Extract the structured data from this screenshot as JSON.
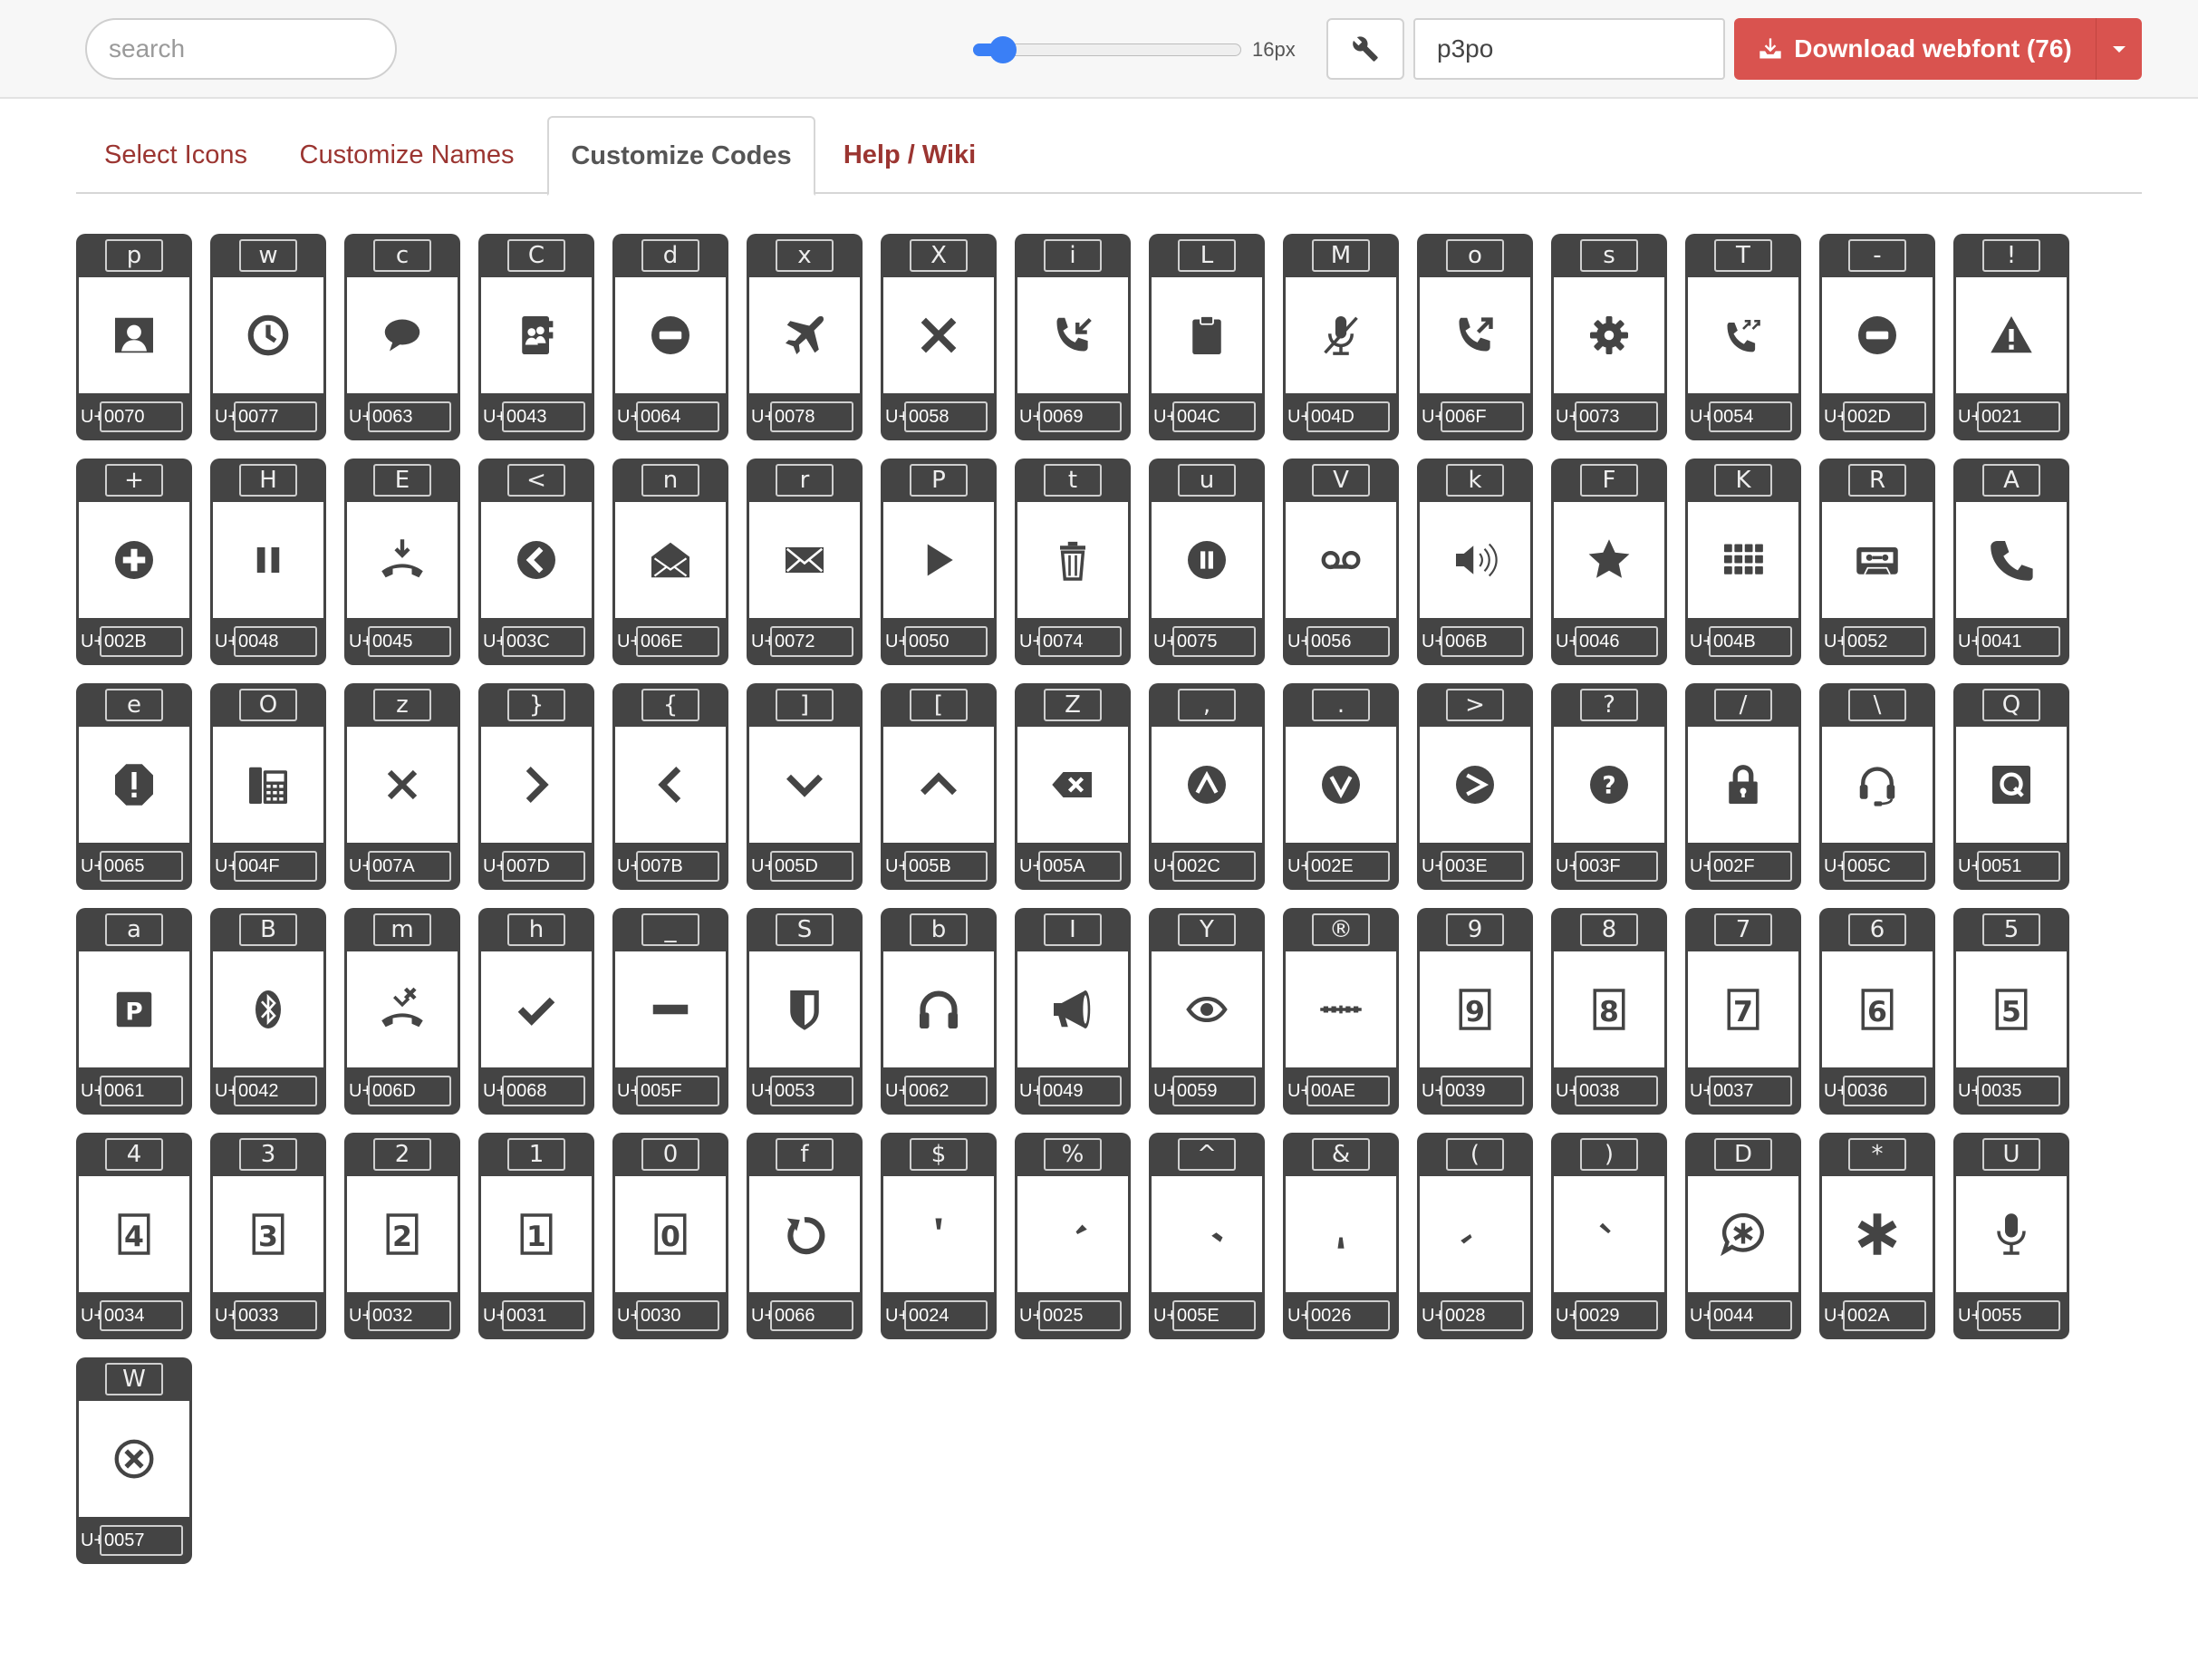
{
  "toolbar": {
    "search_placeholder": "search",
    "font_size_label": "16px",
    "font_size_value": 16,
    "font_size_min": 12,
    "font_size_max": 48,
    "prefix_value": "p3po",
    "download_label": "Download webfont (76)",
    "accent_color": "#d9534f",
    "slider_color": "#3a7ff6"
  },
  "tabs": [
    {
      "label": "Select Icons",
      "active": false
    },
    {
      "label": "Customize Names",
      "active": false
    },
    {
      "label": "Customize Codes",
      "active": true
    },
    {
      "label": "Help / Wiki",
      "active": false
    }
  ],
  "code_prefix": "U+",
  "icons": [
    {
      "key": "p",
      "code": "0070",
      "icon": "contact-portrait-icon"
    },
    {
      "key": "w",
      "code": "0077",
      "icon": "clock-icon"
    },
    {
      "key": "c",
      "code": "0063",
      "icon": "speech-bubble-icon"
    },
    {
      "key": "C",
      "code": "0043",
      "icon": "address-book-icon"
    },
    {
      "key": "d",
      "code": "0064",
      "icon": "minus-circle-icon"
    },
    {
      "key": "x",
      "code": "0078",
      "icon": "airplane-icon"
    },
    {
      "key": "X",
      "code": "0058",
      "icon": "close-x-bold-icon"
    },
    {
      "key": "i",
      "code": "0069",
      "icon": "incoming-call-icon"
    },
    {
      "key": "L",
      "code": "004C",
      "icon": "clipboard-icon"
    },
    {
      "key": "M",
      "code": "004D",
      "icon": "mic-off-icon"
    },
    {
      "key": "o",
      "code": "006F",
      "icon": "outgoing-call-icon"
    },
    {
      "key": "s",
      "code": "0073",
      "icon": "gear-icon"
    },
    {
      "key": "T",
      "code": "0054",
      "icon": "call-transfer-icon"
    },
    {
      "key": "-",
      "code": "002D",
      "icon": "minus-circle-icon"
    },
    {
      "key": "!",
      "code": "0021",
      "icon": "warning-triangle-icon"
    },
    {
      "key": "+",
      "code": "002B",
      "icon": "plus-circle-icon"
    },
    {
      "key": "H",
      "code": "0048",
      "icon": "pause-icon"
    },
    {
      "key": "E",
      "code": "0045",
      "icon": "hang-up-down-icon"
    },
    {
      "key": "<",
      "code": "003C",
      "icon": "back-circle-icon"
    },
    {
      "key": "n",
      "code": "006E",
      "icon": "open-envelope-icon"
    },
    {
      "key": "r",
      "code": "0072",
      "icon": "envelope-icon"
    },
    {
      "key": "P",
      "code": "0050",
      "icon": "play-icon"
    },
    {
      "key": "t",
      "code": "0074",
      "icon": "trash-icon"
    },
    {
      "key": "u",
      "code": "0075",
      "icon": "pause-circle-icon"
    },
    {
      "key": "V",
      "code": "0056",
      "icon": "voicemail-icon"
    },
    {
      "key": "k",
      "code": "006B",
      "icon": "speaker-icon"
    },
    {
      "key": "F",
      "code": "0046",
      "icon": "star-icon"
    },
    {
      "key": "K",
      "code": "004B",
      "icon": "keypad-icon"
    },
    {
      "key": "R",
      "code": "0052",
      "icon": "cassette-icon"
    },
    {
      "key": "A",
      "code": "0041",
      "icon": "phone-icon"
    },
    {
      "key": "e",
      "code": "0065",
      "icon": "alert-octagon-icon"
    },
    {
      "key": "O",
      "code": "004F",
      "icon": "desk-phone-icon"
    },
    {
      "key": "z",
      "code": "007A",
      "icon": "close-x-icon"
    },
    {
      "key": "}",
      "code": "007D",
      "icon": "chevron-right-icon"
    },
    {
      "key": "{",
      "code": "007B",
      "icon": "chevron-left-icon"
    },
    {
      "key": "]",
      "code": "005D",
      "icon": "chevron-down-icon"
    },
    {
      "key": "[",
      "code": "005B",
      "icon": "chevron-up-icon"
    },
    {
      "key": "Z",
      "code": "005A",
      "icon": "backspace-icon"
    },
    {
      "key": ",",
      "code": "002C",
      "icon": "up-circle-icon"
    },
    {
      "key": ".",
      "code": "002E",
      "icon": "down-circle-icon"
    },
    {
      "key": ">",
      "code": "003E",
      "icon": "forward-circle-icon"
    },
    {
      "key": "?",
      "code": "003F",
      "icon": "help-circle-icon"
    },
    {
      "key": "/",
      "code": "002F",
      "icon": "lock-icon"
    },
    {
      "key": "\\",
      "code": "005C",
      "icon": "headset-icon"
    },
    {
      "key": "Q",
      "code": "0051",
      "icon": "q-square-icon"
    },
    {
      "key": "a",
      "code": "0061",
      "icon": "parking-p-icon"
    },
    {
      "key": "B",
      "code": "0042",
      "icon": "bluetooth-icon"
    },
    {
      "key": "m",
      "code": "006D",
      "icon": "missed-call-icon"
    },
    {
      "key": "h",
      "code": "0068",
      "icon": "checkmark-icon"
    },
    {
      "key": "_",
      "code": "005F",
      "icon": "dash-bar-icon"
    },
    {
      "key": "S",
      "code": "0053",
      "icon": "shield-icon"
    },
    {
      "key": "b",
      "code": "0062",
      "icon": "headphones-icon"
    },
    {
      "key": "I",
      "code": "0049",
      "icon": "megaphone-icon"
    },
    {
      "key": "Y",
      "code": "0059",
      "icon": "eye-icon"
    },
    {
      "key": "®",
      "code": "00AE",
      "icon": "wordmark-logo-icon"
    },
    {
      "key": "9",
      "code": "0039",
      "icon": "digit-9-icon",
      "digit": "9"
    },
    {
      "key": "8",
      "code": "0038",
      "icon": "digit-8-icon",
      "digit": "8"
    },
    {
      "key": "7",
      "code": "0037",
      "icon": "digit-7-icon",
      "digit": "7"
    },
    {
      "key": "6",
      "code": "0036",
      "icon": "digit-6-icon",
      "digit": "6"
    },
    {
      "key": "5",
      "code": "0035",
      "icon": "digit-5-icon",
      "digit": "5"
    },
    {
      "key": "4",
      "code": "0034",
      "icon": "digit-4-icon",
      "digit": "4"
    },
    {
      "key": "3",
      "code": "0033",
      "icon": "digit-3-icon",
      "digit": "3"
    },
    {
      "key": "2",
      "code": "0032",
      "icon": "digit-2-icon",
      "digit": "2"
    },
    {
      "key": "1",
      "code": "0031",
      "icon": "digit-1-icon",
      "digit": "1"
    },
    {
      "key": "0",
      "code": "0030",
      "icon": "digit-0-icon",
      "digit": "0"
    },
    {
      "key": "f",
      "code": "0066",
      "icon": "refresh-icon"
    },
    {
      "key": "$",
      "code": "0024",
      "icon": "spinner-segment-top-icon"
    },
    {
      "key": "%",
      "code": "0025",
      "icon": "spinner-segment-topright-icon"
    },
    {
      "key": "^",
      "code": "005E",
      "icon": "spinner-segment-right-icon"
    },
    {
      "key": "&",
      "code": "0026",
      "icon": "spinner-segment-bottom-icon"
    },
    {
      "key": "(",
      "code": "0028",
      "icon": "spinner-segment-left-icon"
    },
    {
      "key": ")",
      "code": "0029",
      "icon": "spinner-segment-topleft-icon"
    },
    {
      "key": "D",
      "code": "0044",
      "icon": "chat-asterisk-icon"
    },
    {
      "key": "*",
      "code": "002A",
      "icon": "asterisk-icon"
    },
    {
      "key": "U",
      "code": "0055",
      "icon": "microphone-icon"
    },
    {
      "key": "W",
      "code": "0057",
      "icon": "close-circle-outline-icon"
    }
  ]
}
